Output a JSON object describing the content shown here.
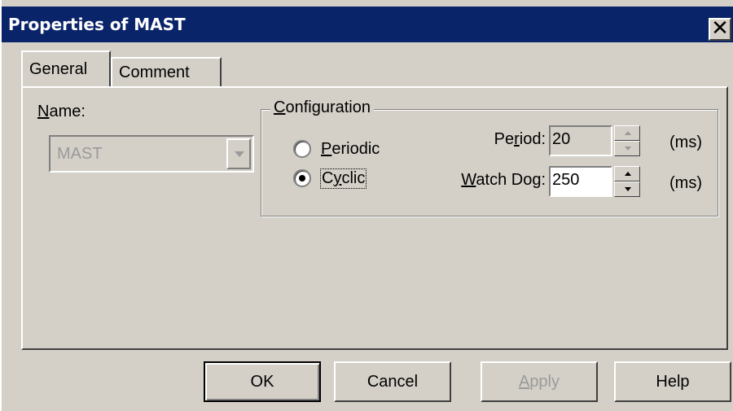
{
  "window": {
    "title": "Properties of MAST",
    "close_glyph": "✕"
  },
  "tabs": [
    {
      "label": "General",
      "active": true
    },
    {
      "label": "Comment",
      "active": false
    }
  ],
  "general": {
    "name_label_underlined": "N",
    "name_label_rest": "ame:",
    "name_value": "MAST",
    "configuration": {
      "label_underlined": "C",
      "label_rest": "onfiguration",
      "options": [
        {
          "underlined": "P",
          "rest": "eriodic",
          "selected": false
        },
        {
          "pre": "C",
          "underlined": "y",
          "rest": "clic",
          "selected": true
        }
      ],
      "period": {
        "label_pre": "Pe",
        "label_underlined": "r",
        "label_rest": "iod:",
        "value": "20",
        "unit": "(ms)",
        "enabled": false
      },
      "watchdog": {
        "label_underlined": "W",
        "label_rest": "atch Dog:",
        "value": "250",
        "unit": "(ms)",
        "enabled": true
      }
    }
  },
  "buttons": {
    "ok": "OK",
    "cancel": "Cancel",
    "apply_underlined": "A",
    "apply_rest": "pply",
    "help": "Help"
  },
  "colors": {
    "titlebar": "#0a246a",
    "face": "#d4d0c8",
    "disabled_text": "#9a9a9a"
  }
}
